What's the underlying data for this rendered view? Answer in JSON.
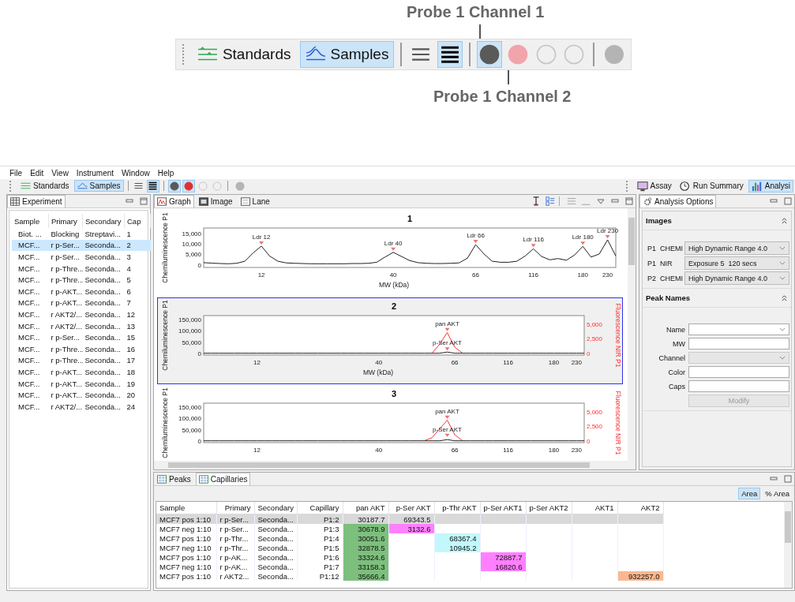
{
  "callout": {
    "top_label": "Probe 1 Channel 1",
    "bottom_label": "Probe 1 Channel 2",
    "toolbar": {
      "buttons": [
        {
          "label": "Standards",
          "selected": false,
          "kind": "standards"
        },
        {
          "label": "Samples",
          "selected": true,
          "kind": "samples"
        }
      ],
      "views": [
        {
          "kind": "compact",
          "selected": false
        },
        {
          "kind": "detailed",
          "selected": true
        }
      ],
      "channels": [
        {
          "color": "#5a5a5a",
          "filled": true,
          "selected": true
        },
        {
          "color": "#f2a4ac",
          "filled": true,
          "selected": false
        },
        {
          "filled": false,
          "selected": false
        },
        {
          "filled": false,
          "selected": false
        }
      ],
      "extra_channel": {
        "color": "#b4b4b4"
      }
    }
  },
  "menu": [
    "File",
    "Edit",
    "View",
    "Instrument",
    "Window",
    "Help"
  ],
  "toolbar": {
    "buttons": [
      {
        "label": "Standards",
        "selected": false,
        "kind": "standards"
      },
      {
        "label": "Samples",
        "selected": true,
        "kind": "samples"
      }
    ],
    "views": [
      {
        "kind": "compact",
        "selected": false
      },
      {
        "kind": "detailed",
        "selected": true
      }
    ],
    "channels": [
      {
        "color": "#5a5a5a",
        "filled": true,
        "selected": true
      },
      {
        "color": "#e03030",
        "filled": true,
        "selected": true
      },
      {
        "filled": false,
        "selected": false
      },
      {
        "filled": false,
        "selected": false
      }
    ],
    "extra_channel": {
      "color": "#b4b4b4"
    },
    "perspectives": [
      {
        "label": "Assay",
        "kind": "assay",
        "selected": false
      },
      {
        "label": "Run Summary",
        "kind": "summary",
        "selected": false
      },
      {
        "label": "Analysi",
        "kind": "analysis",
        "selected": true
      }
    ]
  },
  "experiment": {
    "tab": "Experiment",
    "columns": [
      "Sample",
      "Primary",
      "Secondary",
      "Cap"
    ],
    "rows": [
      {
        "cells": [
          "Biot. ...",
          "Blocking",
          "Streptavi...",
          "1"
        ],
        "selected": false
      },
      {
        "cells": [
          "MCF...",
          "r p-Ser...",
          "Seconda...",
          "2"
        ],
        "selected": true
      },
      {
        "cells": [
          "MCF...",
          "r p-Ser...",
          "Seconda...",
          "3"
        ],
        "selected": false
      },
      {
        "cells": [
          "MCF...",
          "r p-Thre...",
          "Seconda...",
          "4"
        ],
        "selected": false
      },
      {
        "cells": [
          "MCF...",
          "r p-Thre...",
          "Seconda...",
          "5"
        ],
        "selected": false
      },
      {
        "cells": [
          "MCF...",
          "r p-AKT...",
          "Seconda...",
          "6"
        ],
        "selected": false
      },
      {
        "cells": [
          "MCF...",
          "r p-AKT...",
          "Seconda...",
          "7"
        ],
        "selected": false
      },
      {
        "cells": [
          "MCF...",
          "r AKT2/...",
          "Seconda...",
          "12"
        ],
        "selected": false
      },
      {
        "cells": [
          "MCF...",
          "r AKT2/...",
          "Seconda...",
          "13"
        ],
        "selected": false
      },
      {
        "cells": [
          "MCF...",
          "r p-Ser...",
          "Seconda...",
          "15"
        ],
        "selected": false
      },
      {
        "cells": [
          "MCF...",
          "r p-Thre...",
          "Seconda...",
          "16"
        ],
        "selected": false
      },
      {
        "cells": [
          "MCF...",
          "r p-Thre...",
          "Seconda...",
          "17"
        ],
        "selected": false
      },
      {
        "cells": [
          "MCF...",
          "r p-AKT...",
          "Seconda...",
          "18"
        ],
        "selected": false
      },
      {
        "cells": [
          "MCF...",
          "r p-AKT...",
          "Seconda...",
          "19"
        ],
        "selected": false
      },
      {
        "cells": [
          "MCF...",
          "r p-AKT...",
          "Seconda...",
          "20"
        ],
        "selected": false
      },
      {
        "cells": [
          "MCF...",
          "r AKT2/...",
          "Seconda...",
          "24"
        ],
        "selected": false
      }
    ]
  },
  "graph": {
    "tabs": [
      {
        "label": "Graph",
        "kind": "graph",
        "selected": true
      },
      {
        "label": "Image",
        "kind": "image",
        "selected": false
      },
      {
        "label": "Lane",
        "kind": "lane",
        "selected": false
      }
    ],
    "charts": [
      {
        "selected": false,
        "chart_data": {
          "type": "line",
          "title": "1",
          "xlabel": "MW (kDa)",
          "ylim": [
            -1500,
            17500
          ],
          "categories": [
            null,
            null,
            null,
            null,
            null,
            null,
            null,
            "12",
            null,
            null,
            null,
            null,
            null,
            null,
            null,
            null,
            null,
            null,
            null,
            null,
            null,
            null,
            null,
            "40",
            null,
            null,
            null,
            null,
            null,
            null,
            null,
            null,
            null,
            "66",
            null,
            null,
            null,
            null,
            null,
            null,
            "116",
            null,
            null,
            null,
            null,
            null,
            "180",
            null,
            null,
            "230",
            null
          ],
          "yticks": [
            {
              "value": 0,
              "label": "0"
            },
            {
              "value": 5000,
              "label": "5,000"
            },
            {
              "value": 10000,
              "label": "10,000"
            },
            {
              "value": 15000,
              "label": "15,000"
            }
          ],
          "series": [
            {
              "name": "Chemiluminescence P1",
              "color": "#202020",
              "values": [
                800,
                600,
                400,
                300,
                500,
                1500,
                5500,
                8800,
                4000,
                1500,
                700,
                500,
                400,
                300,
                300,
                300,
                300,
                300,
                400,
                400,
                500,
                1000,
                3500,
                5800,
                3800,
                1800,
                800,
                500,
                400,
                400,
                500,
                700,
                3000,
                9500,
                5000,
                1500,
                1000,
                1000,
                1500,
                4000,
                7500,
                3800,
                2200,
                2800,
                2000,
                4500,
                8700,
                3500,
                5000,
                11800,
                4000
              ]
            }
          ],
          "annotations": [
            {
              "x": "12",
              "y": 8800,
              "text": "Ldr 12"
            },
            {
              "x": "40",
              "y": 5800,
              "text": "Ldr 40"
            },
            {
              "x": "66",
              "y": 9500,
              "text": "Ldr 66"
            },
            {
              "x": "116",
              "y": 7500,
              "text": "Ldr 116"
            },
            {
              "x": "180",
              "y": 8700,
              "text": "Ldr 180"
            },
            {
              "x": "230",
              "y": 11800,
              "text": "Ldr 230"
            }
          ]
        }
      },
      {
        "selected": true,
        "chart_data": {
          "type": "line",
          "title": "2",
          "xlabel": "MW (kDa)",
          "ylim": [
            -8000,
            165000
          ],
          "y2lim": [
            -330,
            6400
          ],
          "categories": [
            null,
            null,
            null,
            null,
            null,
            null,
            null,
            "12",
            null,
            null,
            null,
            null,
            null,
            null,
            null,
            null,
            null,
            null,
            null,
            null,
            null,
            null,
            null,
            "40",
            null,
            null,
            null,
            null,
            null,
            null,
            null,
            null,
            null,
            "66",
            null,
            null,
            null,
            null,
            null,
            null,
            "116",
            null,
            null,
            null,
            null,
            null,
            "180",
            null,
            null,
            "230",
            null
          ],
          "yticks": [
            {
              "value": 0,
              "label": "0"
            },
            {
              "value": 50000,
              "label": "50,000"
            },
            {
              "value": 100000,
              "label": "100,000"
            },
            {
              "value": 150000,
              "label": "150,000"
            }
          ],
          "y2ticks": [
            {
              "value": 0,
              "label": "0"
            },
            {
              "value": 2500,
              "label": "2,500"
            },
            {
              "value": 5000,
              "label": "5,000"
            }
          ],
          "series": [
            {
              "name": "Chemiluminescence P1",
              "color": "#202020",
              "values": [
                0,
                0,
                0,
                0,
                0,
                0,
                0,
                0,
                0,
                0,
                0,
                0,
                0,
                0,
                0,
                0,
                0,
                0,
                0,
                0,
                0,
                0,
                0,
                0,
                0,
                0,
                0,
                0,
                0,
                0,
                0,
                0,
                5000,
                0,
                0,
                0,
                0,
                0,
                0,
                0,
                0,
                0,
                0,
                0,
                0,
                0,
                0,
                0,
                0,
                0,
                0
              ]
            },
            {
              "name": "Fluorescence NIR P1",
              "color": "#ff3030",
              "axis": "y2",
              "values": [
                null,
                null,
                null,
                null,
                null,
                null,
                null,
                null,
                null,
                null,
                null,
                null,
                null,
                null,
                null,
                null,
                null,
                null,
                null,
                null,
                null,
                null,
                null,
                null,
                null,
                null,
                null,
                null,
                null,
                null,
                0,
                1500,
                3500,
                1000,
                0,
                null,
                null,
                null,
                null,
                null,
                null,
                null,
                null,
                null,
                null,
                null,
                null,
                null,
                null,
                null,
                null
              ]
            }
          ],
          "annotations": [
            {
              "y": 90000,
              "text": "pan AKT"
            },
            {
              "y": 5000,
              "text": "p-Ser AKT"
            }
          ]
        }
      },
      {
        "selected": false,
        "chart_data": {
          "type": "line",
          "title": "3",
          "ylim": [
            -8000,
            165000
          ],
          "y2lim": [
            -330,
            6400
          ],
          "categories": [
            null,
            null,
            null,
            null,
            null,
            null,
            null,
            "12",
            null,
            null,
            null,
            null,
            null,
            null,
            null,
            null,
            null,
            null,
            null,
            null,
            null,
            null,
            null,
            "40",
            null,
            null,
            null,
            null,
            null,
            null,
            null,
            null,
            null,
            "66",
            null,
            null,
            null,
            null,
            null,
            null,
            "116",
            null,
            null,
            null,
            null,
            null,
            "180",
            null,
            null,
            "230",
            null
          ],
          "yticks": [
            {
              "value": 0,
              "label": "0"
            },
            {
              "value": 50000,
              "label": "50,000"
            },
            {
              "value": 100000,
              "label": "100,000"
            },
            {
              "value": 150000,
              "label": "150,000"
            }
          ],
          "y2ticks": [
            {
              "value": 0,
              "label": "0"
            },
            {
              "value": 2500,
              "label": "2,500"
            },
            {
              "value": 5000,
              "label": "5,000"
            }
          ],
          "series": [
            {
              "name": "Chemiluminescence P1",
              "color": "#202020",
              "values": [
                0,
                0,
                0,
                0,
                0,
                0,
                0,
                0,
                0,
                0,
                0,
                0,
                0,
                0,
                0,
                0,
                0,
                0,
                0,
                0,
                0,
                0,
                0,
                0,
                0,
                0,
                0,
                0,
                0,
                0,
                0,
                0,
                5000,
                0,
                0,
                0,
                0,
                0,
                0,
                0,
                0,
                0,
                0,
                0,
                0,
                0,
                0,
                0,
                0,
                0,
                0
              ]
            },
            {
              "name": "Fluorescence NIR P1",
              "color": "#ff3030",
              "axis": "y2",
              "values": [
                null,
                null,
                null,
                null,
                null,
                null,
                null,
                null,
                null,
                null,
                null,
                null,
                null,
                null,
                null,
                null,
                null,
                null,
                null,
                null,
                null,
                null,
                null,
                null,
                null,
                null,
                null,
                null,
                null,
                0,
                500,
                2000,
                3500,
                1000,
                0,
                null,
                null,
                null,
                null,
                null,
                null,
                null,
                null,
                null,
                null,
                null,
                null,
                null,
                null,
                null,
                null
              ]
            }
          ],
          "annotations": [
            {
              "y": 90000,
              "text": "pan AKT"
            },
            {
              "y": 10000,
              "text": "p-Ser AKT"
            }
          ]
        }
      }
    ]
  },
  "options": {
    "tab": "Analysis Options",
    "images": {
      "title": "Images",
      "expanded": true,
      "rows": [
        {
          "label": "P1  CHEMI",
          "value": "High Dynamic Range 4.0"
        },
        {
          "label": "P1  NIR",
          "value": "Exposure 5  120 secs"
        },
        {
          "label": "P2  CHEMI",
          "value": "High Dynamic Range 4.0"
        }
      ]
    },
    "peaks": {
      "title": "Peak Names",
      "expanded": true,
      "fields": [
        {
          "label": "Name",
          "kind": "select",
          "disabled": false
        },
        {
          "label": "MW",
          "kind": "text",
          "disabled": false
        },
        {
          "label": "Channel",
          "kind": "select",
          "disabled": true
        },
        {
          "label": "Color",
          "kind": "text",
          "disabled": false
        },
        {
          "label": "Caps",
          "kind": "text",
          "disabled": false
        }
      ],
      "button": {
        "label": "Modify",
        "disabled": true
      }
    }
  },
  "results": {
    "tabs": [
      {
        "label": "Peaks",
        "selected": false
      },
      {
        "label": "Capillaries",
        "selected": true
      }
    ],
    "modes": [
      {
        "label": "Area",
        "selected": true
      },
      {
        "label": "% Area",
        "selected": false
      }
    ],
    "columns": [
      "Sample",
      "Primary",
      "Secondary",
      "Capillary",
      "pan AKT",
      "p-Ser AKT",
      "p-Thr AKT",
      "p-Ser AKT1",
      "p-Ser AKT2",
      "AKT1",
      "AKT2"
    ],
    "rows": [
      {
        "selected": true,
        "cells": [
          {
            "text": "MCF7 pos 1:10"
          },
          {
            "text": "r p-Ser..."
          },
          {
            "text": "Seconda..."
          },
          {
            "text": "P1:2"
          },
          {
            "text": "30187.7"
          },
          {
            "text": "69343.5"
          },
          null,
          null,
          null,
          null,
          null
        ]
      },
      {
        "selected": false,
        "cells": [
          {
            "text": "MCF7 neg 1:10"
          },
          {
            "text": "r p-Ser..."
          },
          {
            "text": "Seconda..."
          },
          {
            "text": "P1:3"
          },
          {
            "text": "30678.9",
            "color": "#7dbf7d"
          },
          {
            "text": "3132.6",
            "color": "#ff80ff"
          },
          null,
          null,
          null,
          null,
          null
        ]
      },
      {
        "selected": false,
        "cells": [
          {
            "text": "MCF7 pos 1:10"
          },
          {
            "text": "r p-Thr..."
          },
          {
            "text": "Seconda..."
          },
          {
            "text": "P1:4"
          },
          {
            "text": "30051.6",
            "color": "#7dbf7d"
          },
          null,
          {
            "text": "68367.4",
            "color": "#c2f8fb"
          },
          null,
          null,
          null,
          null
        ]
      },
      {
        "selected": false,
        "cells": [
          {
            "text": "MCF7 neg 1:10"
          },
          {
            "text": "r p-Thr..."
          },
          {
            "text": "Seconda..."
          },
          {
            "text": "P1:5"
          },
          {
            "text": "32878.5",
            "color": "#7dbf7d"
          },
          null,
          {
            "text": "10945.2",
            "color": "#c2f8fb"
          },
          null,
          null,
          null,
          null
        ]
      },
      {
        "selected": false,
        "cells": [
          {
            "text": "MCF7 pos 1:10"
          },
          {
            "text": "r p-AK..."
          },
          {
            "text": "Seconda..."
          },
          {
            "text": "P1:6"
          },
          {
            "text": "33324.6",
            "color": "#7dbf7d"
          },
          null,
          null,
          {
            "text": "72887.7",
            "color": "#ff80ff"
          },
          null,
          null,
          null
        ]
      },
      {
        "selected": false,
        "cells": [
          {
            "text": "MCF7 neg 1:10"
          },
          {
            "text": "r p-AK..."
          },
          {
            "text": "Seconda..."
          },
          {
            "text": "P1:7"
          },
          {
            "text": "33158.3",
            "color": "#7dbf7d"
          },
          null,
          null,
          {
            "text": "16820.6",
            "color": "#ff80ff"
          },
          null,
          null,
          null
        ]
      },
      {
        "selected": false,
        "cells": [
          {
            "text": "MCF7 pos 1:10"
          },
          {
            "text": "r AKT2..."
          },
          {
            "text": "Seconda..."
          },
          {
            "text": "P1:12"
          },
          {
            "text": "35666.4",
            "color": "#7dbf7d"
          },
          null,
          null,
          null,
          null,
          null,
          {
            "text": "932257.0",
            "color": "#fbb890"
          }
        ]
      }
    ]
  }
}
